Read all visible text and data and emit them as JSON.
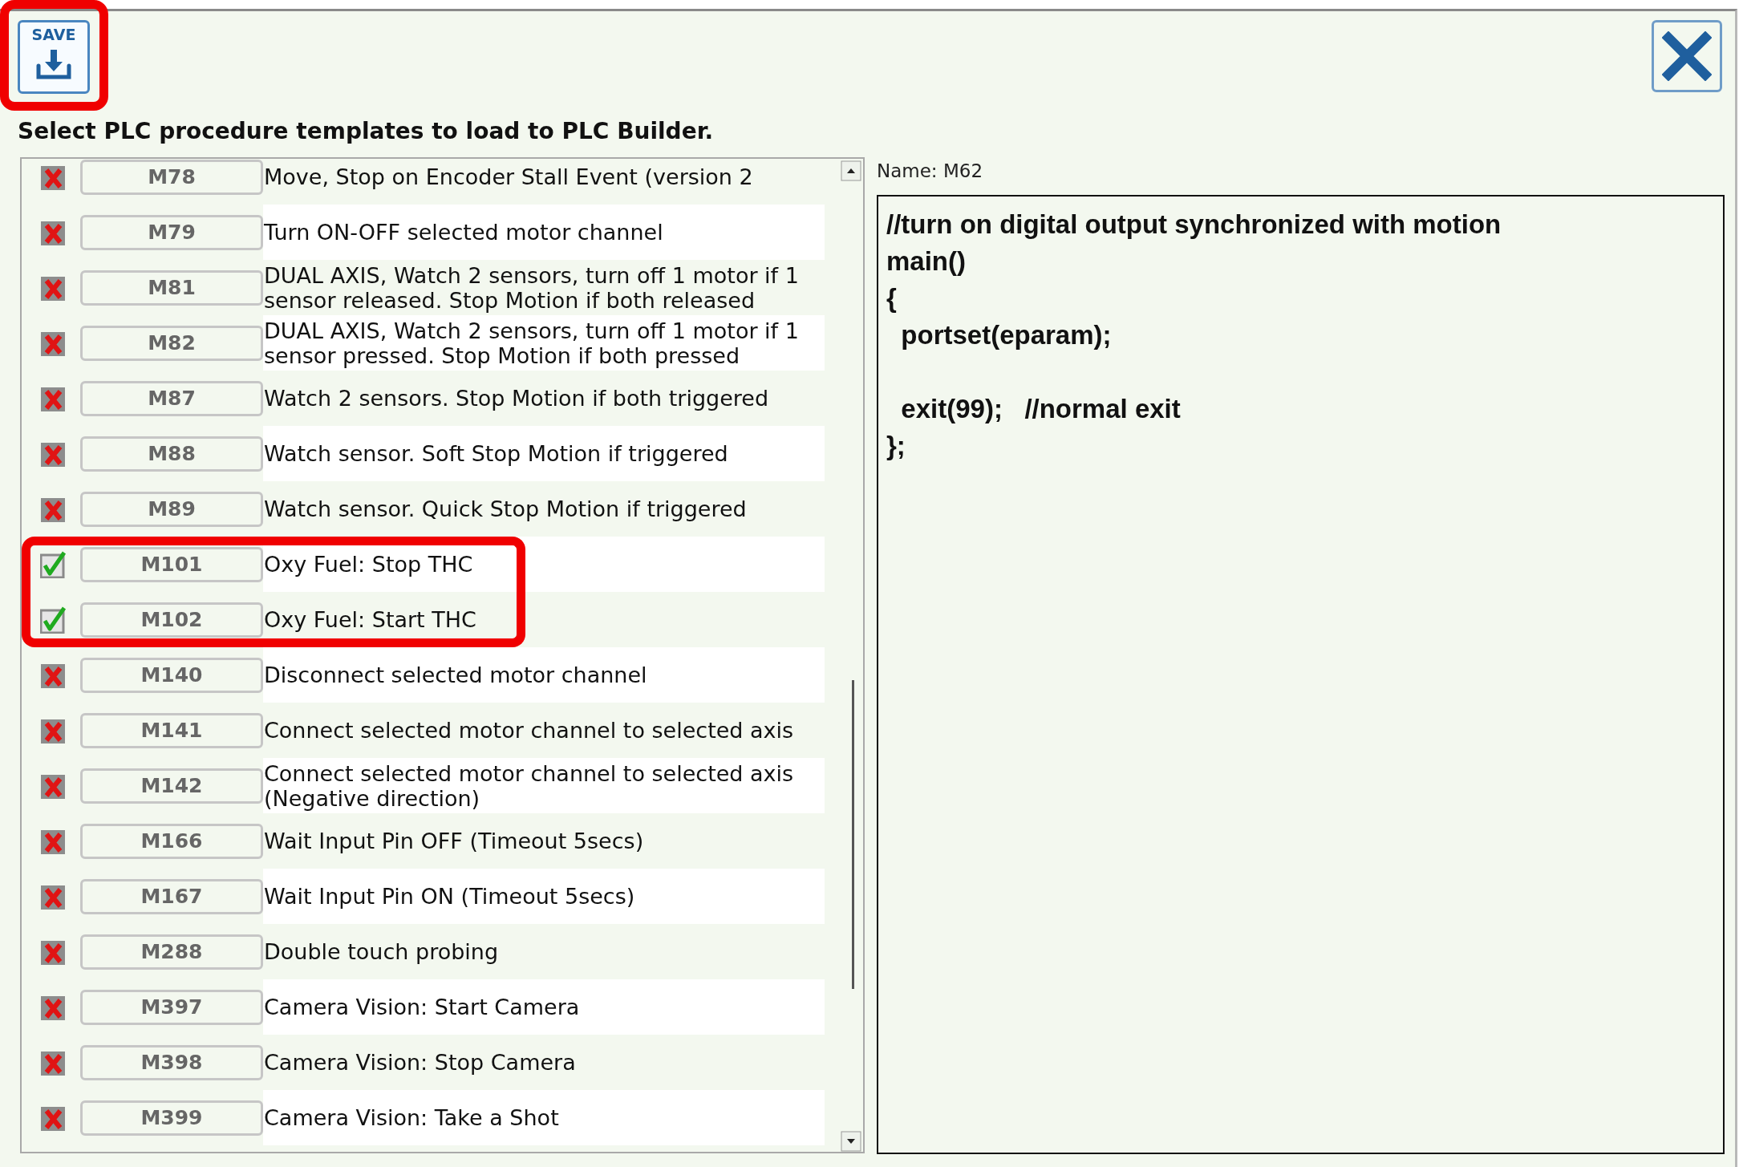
{
  "save_button": {
    "label": "SAVE",
    "highlighted": true
  },
  "title": "Select PLC procedure templates to load to PLC Builder.",
  "templates": [
    {
      "code": "M78",
      "description": "Move, Stop on Encoder Stall Event (version 2",
      "checked": false,
      "highlighted": false
    },
    {
      "code": "M79",
      "description": "Turn ON-OFF selected motor channel",
      "checked": false,
      "highlighted": false
    },
    {
      "code": "M81",
      "description": "DUAL AXIS, Watch 2 sensors, turn off 1 motor if 1 sensor released. Stop Motion if both released",
      "checked": false,
      "highlighted": false
    },
    {
      "code": "M82",
      "description": "DUAL AXIS, Watch 2 sensors, turn off 1 motor if 1 sensor pressed. Stop Motion if both pressed",
      "checked": false,
      "highlighted": false
    },
    {
      "code": "M87",
      "description": "Watch 2 sensors. Stop Motion if both triggered",
      "checked": false,
      "highlighted": false
    },
    {
      "code": "M88",
      "description": "Watch sensor. Soft Stop Motion if triggered",
      "checked": false,
      "highlighted": false
    },
    {
      "code": "M89",
      "description": "Watch sensor. Quick Stop Motion if triggered",
      "checked": false,
      "highlighted": false
    },
    {
      "code": "M101",
      "description": "Oxy Fuel: Stop THC",
      "checked": true,
      "highlighted": true
    },
    {
      "code": "M102",
      "description": "Oxy Fuel: Start THC",
      "checked": true,
      "highlighted": true
    },
    {
      "code": "M140",
      "description": "Disconnect selected motor channel",
      "checked": false,
      "highlighted": false
    },
    {
      "code": "M141",
      "description": "Connect selected motor channel to selected axis",
      "checked": false,
      "highlighted": false
    },
    {
      "code": "M142",
      "description": "Connect selected motor channel to selected axis (Negative direction)",
      "checked": false,
      "highlighted": false
    },
    {
      "code": "M166",
      "description": "Wait Input Pin OFF (Timeout 5secs)",
      "checked": false,
      "highlighted": false
    },
    {
      "code": "M167",
      "description": "Wait Input Pin ON (Timeout 5secs)",
      "checked": false,
      "highlighted": false
    },
    {
      "code": "M288",
      "description": "Double touch probing",
      "checked": false,
      "highlighted": false
    },
    {
      "code": "M397",
      "description": "Camera Vision: Start Camera",
      "checked": false,
      "highlighted": false
    },
    {
      "code": "M398",
      "description": "Camera Vision: Stop Camera",
      "checked": false,
      "highlighted": false
    },
    {
      "code": "M399",
      "description": "Camera Vision: Take a Shot",
      "checked": false,
      "highlighted": false
    }
  ],
  "preview": {
    "name": "Name: M62",
    "code": "//turn on digital output synchronized with motion\nmain()\n{\n  portset(eparam);\n\n  exit(99);   //normal exit\n};"
  }
}
